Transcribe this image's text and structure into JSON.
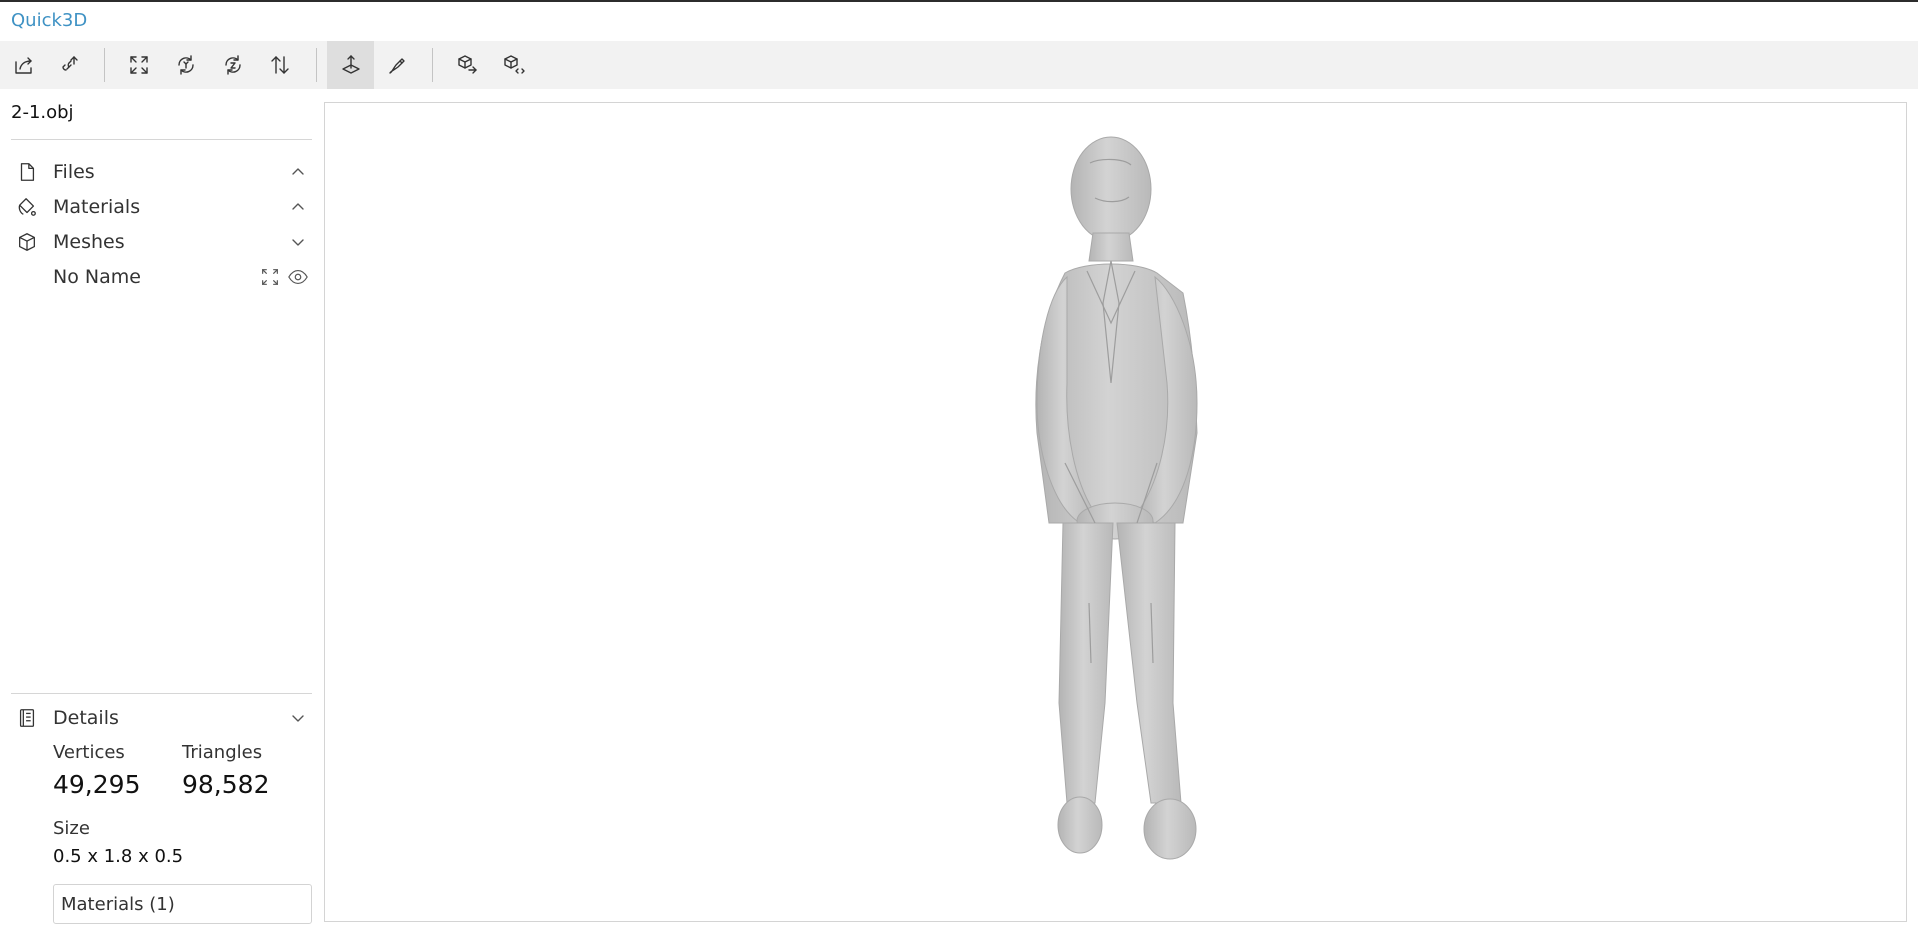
{
  "app": {
    "title": "Quick3D"
  },
  "toolbar": {
    "buttons": [
      {
        "name": "open-file",
        "icon": "open-file-icon"
      },
      {
        "name": "open-url",
        "icon": "open-url-icon"
      },
      {
        "name": "fit-to-window",
        "icon": "fit-window-icon"
      },
      {
        "name": "set-up-y",
        "icon": "up-y-icon"
      },
      {
        "name": "set-up-z",
        "icon": "up-z-icon"
      },
      {
        "name": "flip-up",
        "icon": "flip-icon"
      },
      {
        "name": "fixed-up-vector",
        "icon": "fixed-up-icon",
        "active": true
      },
      {
        "name": "edges",
        "icon": "edges-icon"
      },
      {
        "name": "export-model",
        "icon": "export-icon"
      },
      {
        "name": "share-model",
        "icon": "share-icon"
      }
    ]
  },
  "sidebar": {
    "filename": "2-1.obj",
    "tree": {
      "files": {
        "label": "Files",
        "icon": "file-icon",
        "chevron": "up"
      },
      "materials": {
        "label": "Materials",
        "icon": "materials-icon",
        "chevron": "up"
      },
      "meshes": {
        "label": "Meshes",
        "icon": "cube-icon",
        "chevron": "down"
      },
      "mesh_item": {
        "label": "No Name",
        "icons": [
          "fit-mesh-icon",
          "eye-icon"
        ]
      }
    },
    "details": {
      "label": "Details",
      "icon": "details-icon",
      "chevron": "down",
      "vertices_label": "Vertices",
      "vertices_value": "49,295",
      "triangles_label": "Triangles",
      "triangles_value": "98,582",
      "size_label": "Size",
      "size_value": "0.5 x 1.8 x 0.5",
      "materials_button": "Materials (1)"
    }
  },
  "viewport": {
    "model_color": "#c9c9c9",
    "background": "#ffffff"
  },
  "colors": {
    "accent": "#3f92c4",
    "toolbar_bg": "#f2f2f2",
    "active_bg": "#dedede"
  }
}
